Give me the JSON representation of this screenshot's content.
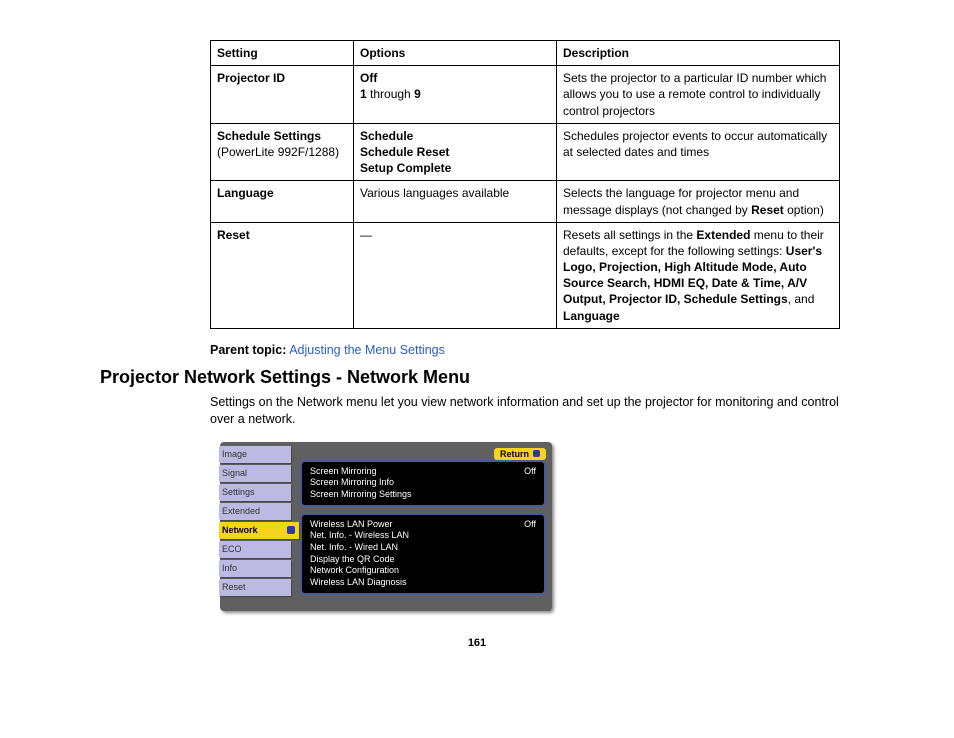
{
  "table": {
    "headers": {
      "c1": "Setting",
      "c2": "Options",
      "c3": "Description"
    },
    "rows": [
      {
        "setting": "Projector ID",
        "settingNote": "",
        "optBold1": "Off",
        "optMidA": "1",
        "optMidT": " through ",
        "optMidB": "9",
        "desc": "Sets the projector to a particular ID number which allows you to use a remote control to individually control projectors"
      },
      {
        "setting": "Schedule Settings",
        "settingNote": "(PowerLite 992F/1288)",
        "optBold1": "Schedule",
        "optBold2": "Schedule Reset",
        "optBold3": "Setup Complete",
        "desc": "Schedules projector events to occur automatically at selected dates and times"
      },
      {
        "setting": "Language",
        "opt": "Various languages available",
        "descA": "Selects the language for projector menu and message displays (not changed by ",
        "descBold": "Reset",
        "descB": " option)"
      },
      {
        "setting": "Reset",
        "opt": "—",
        "descA": "Resets all settings in the ",
        "dExt": "Extended",
        "descB": " menu to their defaults, except for the following settings: ",
        "dList": "User's Logo, Projection, High Altitude Mode, Auto Source Search, HDMI EQ, Date & Time, A/V Output, Projector ID, Schedule Settings",
        "dAnd": ", and ",
        "dLang": "Language"
      }
    ]
  },
  "parentTopic": {
    "label": "Parent topic:",
    "link": "Adjusting the Menu Settings"
  },
  "heading": "Projector Network Settings - Network Menu",
  "intro": "Settings on the Network menu let you view network information and set up the projector for monitoring and control over a network.",
  "osd": {
    "returnLabel": "Return",
    "sidebar": [
      "Image",
      "Signal",
      "Settings",
      "Extended",
      "Network",
      "ECO",
      "Info",
      "Reset"
    ],
    "block1": [
      {
        "l": "Screen Mirroring",
        "r": "Off"
      },
      {
        "l": "Screen Mirroring Info",
        "r": ""
      },
      {
        "l": "Screen Mirroring Settings",
        "r": ""
      }
    ],
    "block2": [
      {
        "l": "Wireless LAN Power",
        "r": "Off"
      },
      {
        "l": "Net. Info. - Wireless LAN",
        "r": ""
      },
      {
        "l": "Net. Info. - Wired LAN",
        "r": ""
      },
      {
        "l": "Display the QR Code",
        "r": ""
      },
      {
        "l": "Network Configuration",
        "r": ""
      },
      {
        "l": "Wireless LAN Diagnosis",
        "r": ""
      }
    ]
  },
  "pageNumber": "161"
}
